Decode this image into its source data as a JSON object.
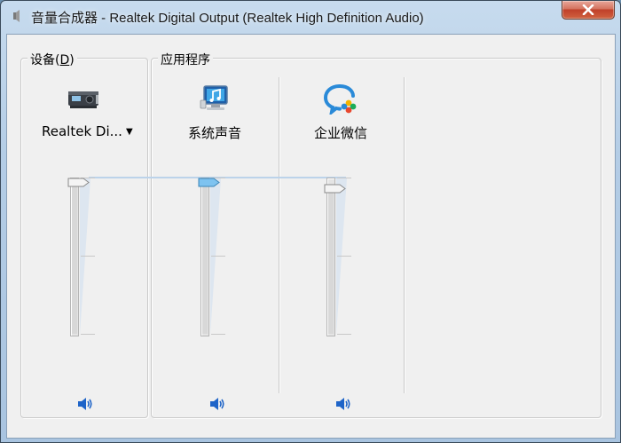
{
  "window": {
    "title": "音量合成器 - Realtek Digital Output (Realtek High Definition Audio)"
  },
  "device_group": {
    "label_prefix": "设备(",
    "label_accel": "D",
    "label_suffix": ")",
    "device_name": "Realtek Di...",
    "dropdown_arrow": "▼",
    "icon": "speaker-device-icon",
    "volume_level": 0.97
  },
  "apps_group": {
    "label": "应用程序",
    "items": [
      {
        "label": "系统声音",
        "icon": "system-sounds-icon",
        "volume_level": 0.97,
        "selected": true
      },
      {
        "label": "企业微信",
        "icon": "wecom-icon",
        "volume_level": 0.93,
        "selected": false
      }
    ]
  },
  "colors": {
    "close_button": "#c0402a",
    "selected_thumb": "#7ec3f0",
    "level_line": "#bcd3ea",
    "speaker_blue": "#1e64c8"
  }
}
